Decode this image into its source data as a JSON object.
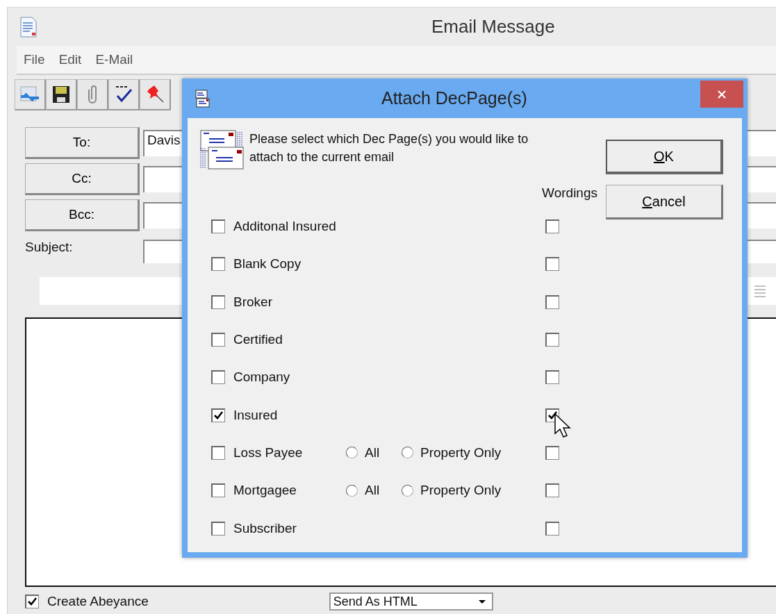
{
  "window": {
    "title": "Email Message"
  },
  "menu": [
    "File",
    "Edit",
    "E-Mail"
  ],
  "address": [
    {
      "label": "To:",
      "value": "Davis"
    },
    {
      "label": "Cc:"
    },
    {
      "label": "Bcc:"
    }
  ],
  "subject": {
    "label": "Subject:"
  },
  "footer": {
    "create_abeyance": {
      "label": "Create Abeyance",
      "checked": true
    },
    "format": {
      "value": "Send As HTML"
    }
  },
  "dialog": {
    "title": "Attach DecPage(s)",
    "instructions": "Please select which Dec Page(s) you would like to attach to the current email",
    "buttons": [
      "OK",
      "Cancel"
    ],
    "wordings_header": "Wordings",
    "options": [
      {
        "label": "Additonal Insured",
        "checked": false,
        "wordings": false
      },
      {
        "label": "Blank Copy",
        "checked": false,
        "wordings": false
      },
      {
        "label": "Broker",
        "checked": false,
        "wordings": false
      },
      {
        "label": "Certified",
        "checked": false,
        "wordings": false
      },
      {
        "label": "Company",
        "checked": false,
        "wordings": false
      },
      {
        "label": "Insured",
        "checked": true,
        "wordings": true
      },
      {
        "label": "Loss Payee",
        "checked": false,
        "wordings": false,
        "choices": [
          {
            "label": "All",
            "selected": false
          },
          {
            "label": "Property Only",
            "selected": false
          }
        ]
      },
      {
        "label": "Mortgagee",
        "checked": false,
        "wordings": false,
        "choices": [
          {
            "label": "All",
            "selected": false
          },
          {
            "label": "Property Only",
            "selected": false
          }
        ]
      },
      {
        "label": "Subscriber",
        "checked": false,
        "wordings": false
      }
    ]
  }
}
